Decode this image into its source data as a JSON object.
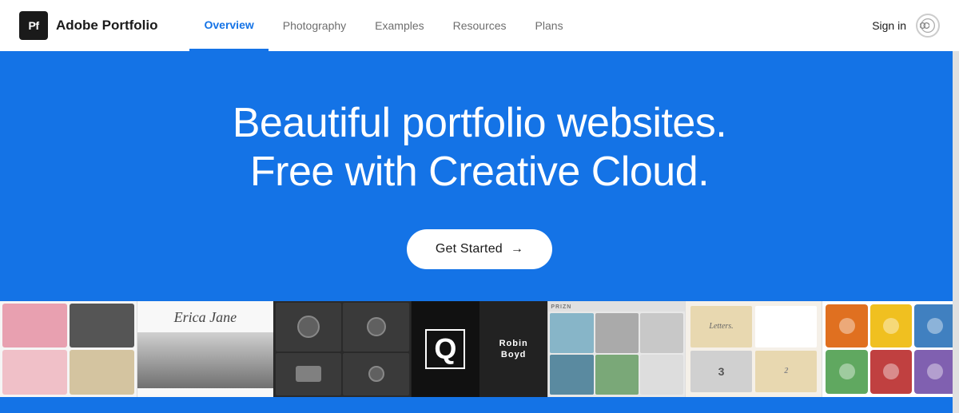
{
  "navbar": {
    "logo_initials": "Pf",
    "logo_title": "Adobe Portfolio",
    "nav_items": [
      {
        "id": "overview",
        "label": "Overview",
        "active": true
      },
      {
        "id": "photography",
        "label": "Photography",
        "active": false
      },
      {
        "id": "examples",
        "label": "Examples",
        "active": false
      },
      {
        "id": "resources",
        "label": "Resources",
        "active": false
      },
      {
        "id": "plans",
        "label": "Plans",
        "active": false
      }
    ],
    "sign_in_label": "Sign in"
  },
  "hero": {
    "headline_line1": "Beautiful portfolio websites.",
    "headline_line2": "Free with Creative Cloud.",
    "cta_label": "Get Started",
    "cta_arrow": "→"
  },
  "thumbnails": [
    {
      "id": "thumb1",
      "type": "grid-pink"
    },
    {
      "id": "thumb2",
      "type": "erica-jane",
      "name": "Erica Jane"
    },
    {
      "id": "thumb3",
      "type": "watches"
    },
    {
      "id": "thumb4",
      "type": "robin-boyd",
      "name1": "Robin",
      "name2": "Boyd",
      "letter": "Q"
    },
    {
      "id": "thumb5",
      "type": "prizn",
      "label": "PRIZN"
    },
    {
      "id": "thumb6",
      "type": "letters"
    },
    {
      "id": "thumb7",
      "type": "circles"
    }
  ],
  "colors": {
    "brand_blue": "#1473e6",
    "nav_bg": "#ffffff",
    "text_dark": "#1a1a1a",
    "text_muted": "#6e6e6e"
  }
}
